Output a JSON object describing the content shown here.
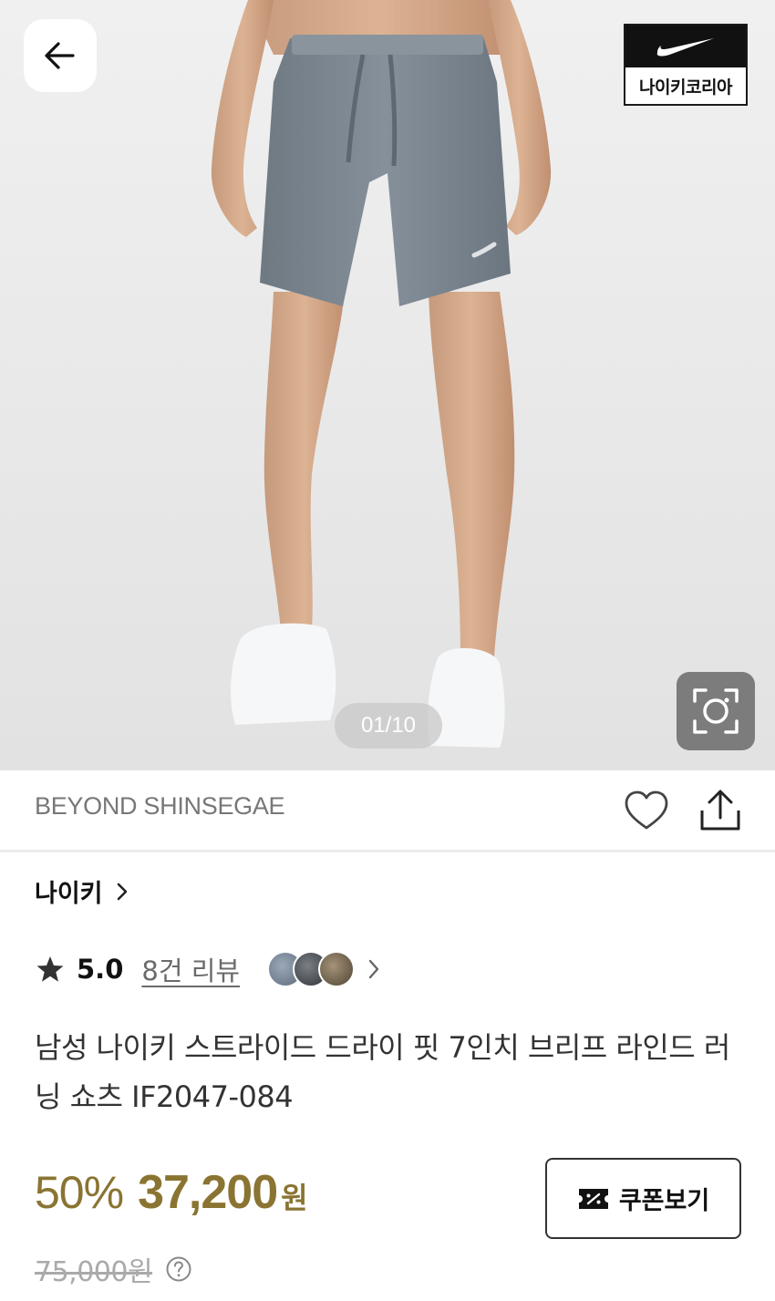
{
  "gallery": {
    "counter": "01/10",
    "brand_logo_text": "나이키코리아"
  },
  "store": {
    "name": "BEYOND SHINSEGAE"
  },
  "brand": {
    "name": "나이키"
  },
  "rating": {
    "score": "5.0",
    "review_link": "8건 리뷰"
  },
  "product": {
    "title": "남성 나이키 스트라이드 드라이 핏 7인치 브리프 라인드 러닝 쇼츠 IF2047-084"
  },
  "price": {
    "discount": "50%",
    "sale": "37,200",
    "currency": "원",
    "original": "75,000원"
  },
  "coupon": {
    "label": "쿠폰보기"
  },
  "colors": {
    "accent_gold": "#8a7432",
    "shorts_grey": "#7c868f"
  }
}
